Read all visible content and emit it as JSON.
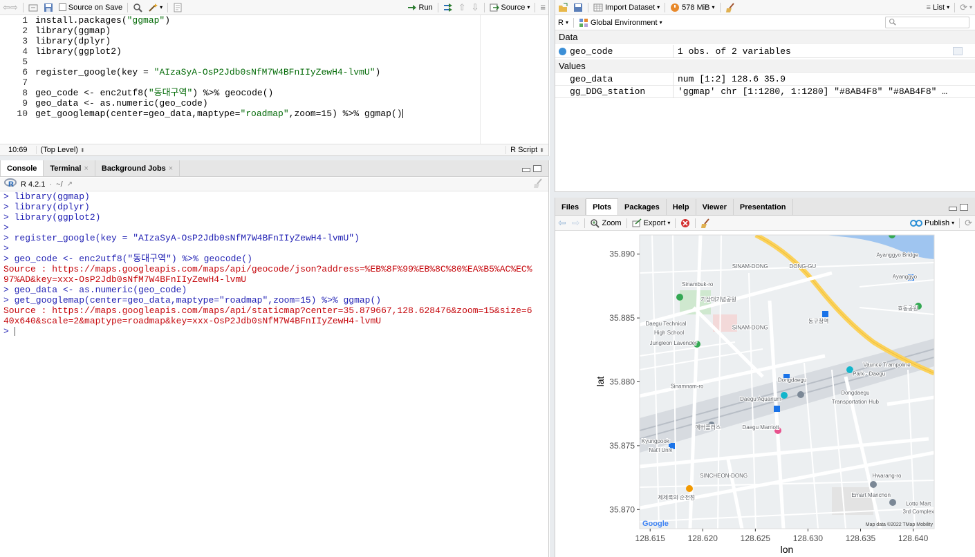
{
  "editor": {
    "toolbar": {
      "source_on_save": "Source on Save",
      "run": "Run",
      "source": "Source"
    },
    "lines": [
      {
        "n": "1",
        "parts": [
          {
            "t": "install.packages(",
            "c": "fn"
          },
          {
            "t": "\"ggmap\"",
            "c": "str"
          },
          {
            "t": ")",
            "c": "fn"
          }
        ]
      },
      {
        "n": "2",
        "parts": [
          {
            "t": "library(ggmap)",
            "c": "fn"
          }
        ]
      },
      {
        "n": "3",
        "parts": [
          {
            "t": "library(dplyr)",
            "c": "fn"
          }
        ]
      },
      {
        "n": "4",
        "parts": [
          {
            "t": "library(ggplot2)",
            "c": "fn"
          }
        ]
      },
      {
        "n": "5",
        "parts": []
      },
      {
        "n": "6",
        "parts": [
          {
            "t": "register_google(key = ",
            "c": "fn"
          },
          {
            "t": "\"AIzaSyA-OsP2Jdb0sNfM7W4BFnIIyZewH4-lvmU\"",
            "c": "str"
          },
          {
            "t": ")",
            "c": "fn"
          }
        ]
      },
      {
        "n": "7",
        "parts": []
      },
      {
        "n": "8",
        "parts": [
          {
            "t": "geo_code <- enc2utf8(",
            "c": "fn"
          },
          {
            "t": "\"동대구역\"",
            "c": "str"
          },
          {
            "t": ") %>% geocode()",
            "c": "fn"
          }
        ]
      },
      {
        "n": "9",
        "parts": [
          {
            "t": "geo_data <- as.numeric(geo_code)",
            "c": "fn"
          }
        ]
      },
      {
        "n": "10",
        "parts": [
          {
            "t": "get_googlemap(center=geo_data,maptype=",
            "c": "fn"
          },
          {
            "t": "\"roadmap\"",
            "c": "str"
          },
          {
            "t": ",zoom=15) %>% ggmap()",
            "c": "fn"
          }
        ]
      }
    ],
    "status": {
      "position": "10:69",
      "scope": "(Top Level)",
      "lang": "R Script"
    }
  },
  "console": {
    "tabs": [
      "Console",
      "Terminal",
      "Background Jobs"
    ],
    "r_version": "R 4.2.1",
    "path": "~/",
    "lines": [
      {
        "t": "> library(ggmap)",
        "c": "blue"
      },
      {
        "t": "> library(dplyr)",
        "c": "blue"
      },
      {
        "t": "> library(ggplot2)",
        "c": "blue"
      },
      {
        "t": ">",
        "c": "blue"
      },
      {
        "t": "> register_google(key = \"AIzaSyA-OsP2Jdb0sNfM7W4BFnIIyZewH4-lvmU\")",
        "c": "blue"
      },
      {
        "t": ">",
        "c": "blue"
      },
      {
        "t": "> geo_code <- enc2utf8(\"동대구역\") %>% geocode()",
        "c": "blue"
      },
      {
        "t": "Source : https://maps.googleapis.com/maps/api/geocode/json?address=%EB%8F%99%EB%8C%80%EA%B5%AC%EC%",
        "c": "red"
      },
      {
        "t": "97%AD&key=xxx-OsP2Jdb0sNfM7W4BFnIIyZewH4-lvmU",
        "c": "red"
      },
      {
        "t": "> geo_data <- as.numeric(geo_code)",
        "c": "blue"
      },
      {
        "t": "> get_googlemap(center=geo_data,maptype=\"roadmap\",zoom=15) %>% ggmap()",
        "c": "blue"
      },
      {
        "t": "Source : https://maps.googleapis.com/maps/api/staticmap?center=35.879667,128.628476&zoom=15&size=6",
        "c": "red"
      },
      {
        "t": "40x640&scale=2&maptype=roadmap&key=xxx-OsP2Jdb0sNfM7W4BFnIIyZewH4-lvmU",
        "c": "red"
      },
      {
        "t": "> ",
        "c": "blue"
      }
    ]
  },
  "environment": {
    "toolbar": {
      "import_dataset": "Import Dataset",
      "memory": "578 MiB",
      "view_mode": "List"
    },
    "lang": "R",
    "scope": "Global Environment",
    "search_placeholder": "",
    "data_header": "Data",
    "values_header": "Values",
    "data": [
      {
        "name": "geo_code",
        "value": "1 obs. of 2 variables"
      }
    ],
    "values": [
      {
        "name": "geo_data",
        "value": "num [1:2] 128.6 35.9"
      },
      {
        "name": "gg_DDG_station",
        "value": "'ggmap' chr [1:1280, 1:1280] \"#8AB4F8\" \"#8AB4F8\" …"
      }
    ]
  },
  "plots": {
    "tabs": [
      "Files",
      "Plots",
      "Packages",
      "Help",
      "Viewer",
      "Presentation"
    ],
    "toolbar": {
      "zoom": "Zoom",
      "export": "Export",
      "publish": "Publish"
    },
    "chart_data": {
      "type": "map",
      "xlabel": "lon",
      "ylabel": "lat",
      "x_ticks": [
        "128.615",
        "128.620",
        "128.625",
        "128.630",
        "128.635",
        "128.640"
      ],
      "y_ticks": [
        "35.890",
        "35.885",
        "35.880",
        "35.875",
        "35.870"
      ],
      "xlim": [
        128.614,
        128.642
      ],
      "ylim": [
        35.8685,
        35.8915
      ],
      "map_labels": [
        {
          "text": "Ayanggyo Bridge",
          "lon": 128.6385,
          "lat": 35.8898
        },
        {
          "text": "SINAM-DONG",
          "lon": 128.6245,
          "lat": 35.8889
        },
        {
          "text": "DONG-GU",
          "lon": 128.6295,
          "lat": 35.8889
        },
        {
          "text": "Sinambuk-ro",
          "lon": 128.6195,
          "lat": 35.8875
        },
        {
          "text": "기상대기념공원",
          "lon": 128.6215,
          "lat": 35.8863
        },
        {
          "text": "Daegu Technical",
          "lon": 128.6165,
          "lat": 35.8844
        },
        {
          "text": "High School",
          "lon": 128.6168,
          "lat": 35.8837
        },
        {
          "text": "SINAM-DONG",
          "lon": 128.6245,
          "lat": 35.8841
        },
        {
          "text": "동구청역",
          "lon": 128.631,
          "lat": 35.8846
        },
        {
          "text": "효동공원",
          "lon": 128.6395,
          "lat": 35.8856
        },
        {
          "text": "Ayanggyo",
          "lon": 128.6392,
          "lat": 35.8881
        },
        {
          "text": "Jungleon Lavender",
          "lon": 128.6172,
          "lat": 35.8829
        },
        {
          "text": "Vaunce Trampoline",
          "lon": 128.6375,
          "lat": 35.8812
        },
        {
          "text": "Park - Daegu",
          "lon": 128.6358,
          "lat": 35.8805
        },
        {
          "text": "Dongdaegu",
          "lon": 128.6285,
          "lat": 35.88
        },
        {
          "text": "Daegu Aquarium",
          "lon": 128.6255,
          "lat": 35.8785
        },
        {
          "text": "Dongdaegu",
          "lon": 128.6345,
          "lat": 35.879
        },
        {
          "text": "Transportation Hub",
          "lon": 128.6345,
          "lat": 35.8783
        },
        {
          "text": "Sinamnam-ro",
          "lon": 128.6185,
          "lat": 35.8795
        },
        {
          "text": "에버플러스",
          "lon": 128.6205,
          "lat": 35.8763
        },
        {
          "text": "Daegu Marriott",
          "lon": 128.6255,
          "lat": 35.8763
        },
        {
          "text": "Kyungpook",
          "lon": 128.6155,
          "lat": 35.8752
        },
        {
          "text": "Nat'l Univ",
          "lon": 128.616,
          "lat": 35.8745
        },
        {
          "text": "SINCHEON-DONG",
          "lon": 128.622,
          "lat": 35.8725
        },
        {
          "text": "Hwarang-ro",
          "lon": 128.6375,
          "lat": 35.8725
        },
        {
          "text": "Emart Manchon",
          "lon": 128.636,
          "lat": 35.871
        },
        {
          "text": "제제룩의 순천점",
          "lon": 128.6175,
          "lat": 35.8708
        },
        {
          "text": "Lotte Mart",
          "lon": 128.6405,
          "lat": 35.8703
        },
        {
          "text": "3rd Complex",
          "lon": 128.6405,
          "lat": 35.8697
        }
      ],
      "attribution": "Map data ©2022 TMap Mobility",
      "logo": "Google"
    }
  }
}
